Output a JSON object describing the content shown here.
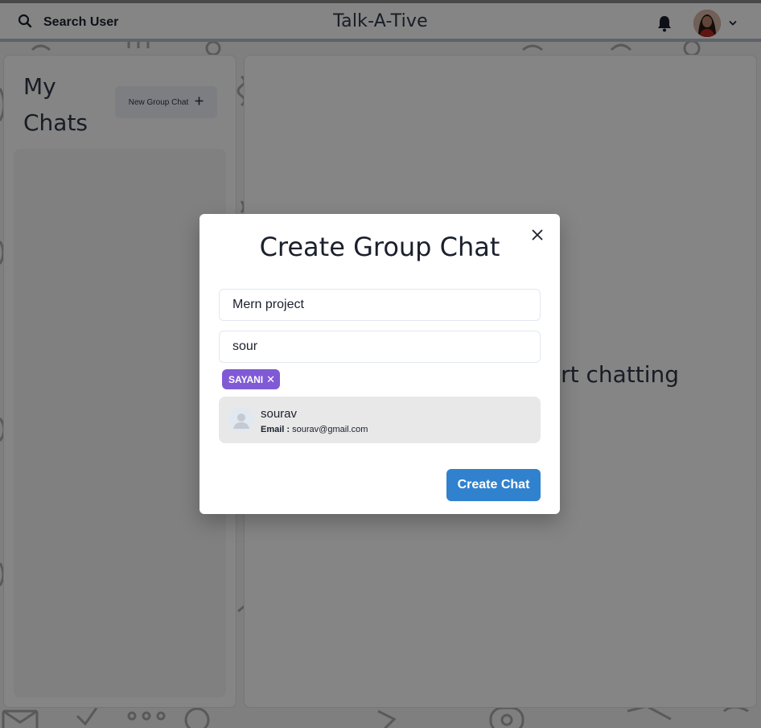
{
  "header": {
    "search_label": "Search User",
    "app_title": "Talk-A-Tive",
    "notification_icon": "bell-icon",
    "profile_menu_icon": "chevron-down-icon"
  },
  "left_panel": {
    "title_line1": "My",
    "title_line2": "Chats",
    "new_group_label": "New Group Chat",
    "new_group_icon": "plus-icon"
  },
  "right_panel": {
    "empty_text": "Click on a user to start chatting"
  },
  "modal": {
    "title": "Create Group Chat",
    "chat_name_value": "Mern project",
    "search_value": "sour",
    "selected_users": [
      {
        "label": "SAYANI"
      }
    ],
    "results": [
      {
        "name": "sourav",
        "email_label": "Email :",
        "email": "sourav@gmail.com"
      }
    ],
    "create_label": "Create Chat",
    "close_icon": "close-icon"
  },
  "colors": {
    "accent_blue": "#3182ce",
    "badge_purple": "#805ad5",
    "header_border": "#b8bcc9"
  }
}
